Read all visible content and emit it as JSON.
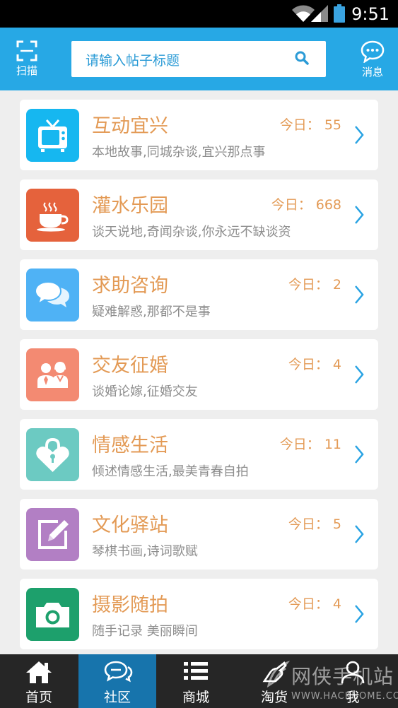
{
  "status_bar": {
    "time": "9:51"
  },
  "header": {
    "scan_label": "扫描",
    "search_placeholder": "请输入帖子标题",
    "message_label": "消息"
  },
  "forums": [
    {
      "title": "互动宜兴",
      "desc": "本地故事,同城杂谈,宜兴那点事",
      "today": "今日： 55",
      "icon": "tv-icon",
      "color": "#16b7f0"
    },
    {
      "title": "灌水乐园",
      "desc": "谈天说地,奇闻杂谈,你永远不缺谈资",
      "today": "今日： 668",
      "icon": "coffee-cup-icon",
      "color": "#e5623c"
    },
    {
      "title": "求助咨询",
      "desc": "疑难解惑,那都不是事",
      "today": "今日： 2",
      "icon": "chat-bubbles-icon",
      "color": "#4fb2f5"
    },
    {
      "title": "交友征婚",
      "desc": "谈婚论嫁,征婚交友",
      "today": "今日： 4",
      "icon": "couple-icon",
      "color": "#f38a72"
    },
    {
      "title": "情感生活",
      "desc": "倾述情感生活,最美青春自拍",
      "today": "今日： 11",
      "icon": "heart-lock-icon",
      "color": "#6ccac2"
    },
    {
      "title": "文化驿站",
      "desc": "琴棋书画,诗词歌赋",
      "today": "今日： 5",
      "icon": "edit-icon",
      "color": "#b27fc4"
    },
    {
      "title": "摄影随拍",
      "desc": "随手记录 美丽瞬间",
      "today": "今日： 4",
      "icon": "camera-icon",
      "color": "#1da06c"
    }
  ],
  "bottom_nav": {
    "home": "首页",
    "community": "社区",
    "mall": "商城",
    "deals": "淘货",
    "me": "我",
    "active": "community"
  },
  "watermark": {
    "text": "网侠手机站",
    "url": "WWW.HACKHOME.COM"
  }
}
